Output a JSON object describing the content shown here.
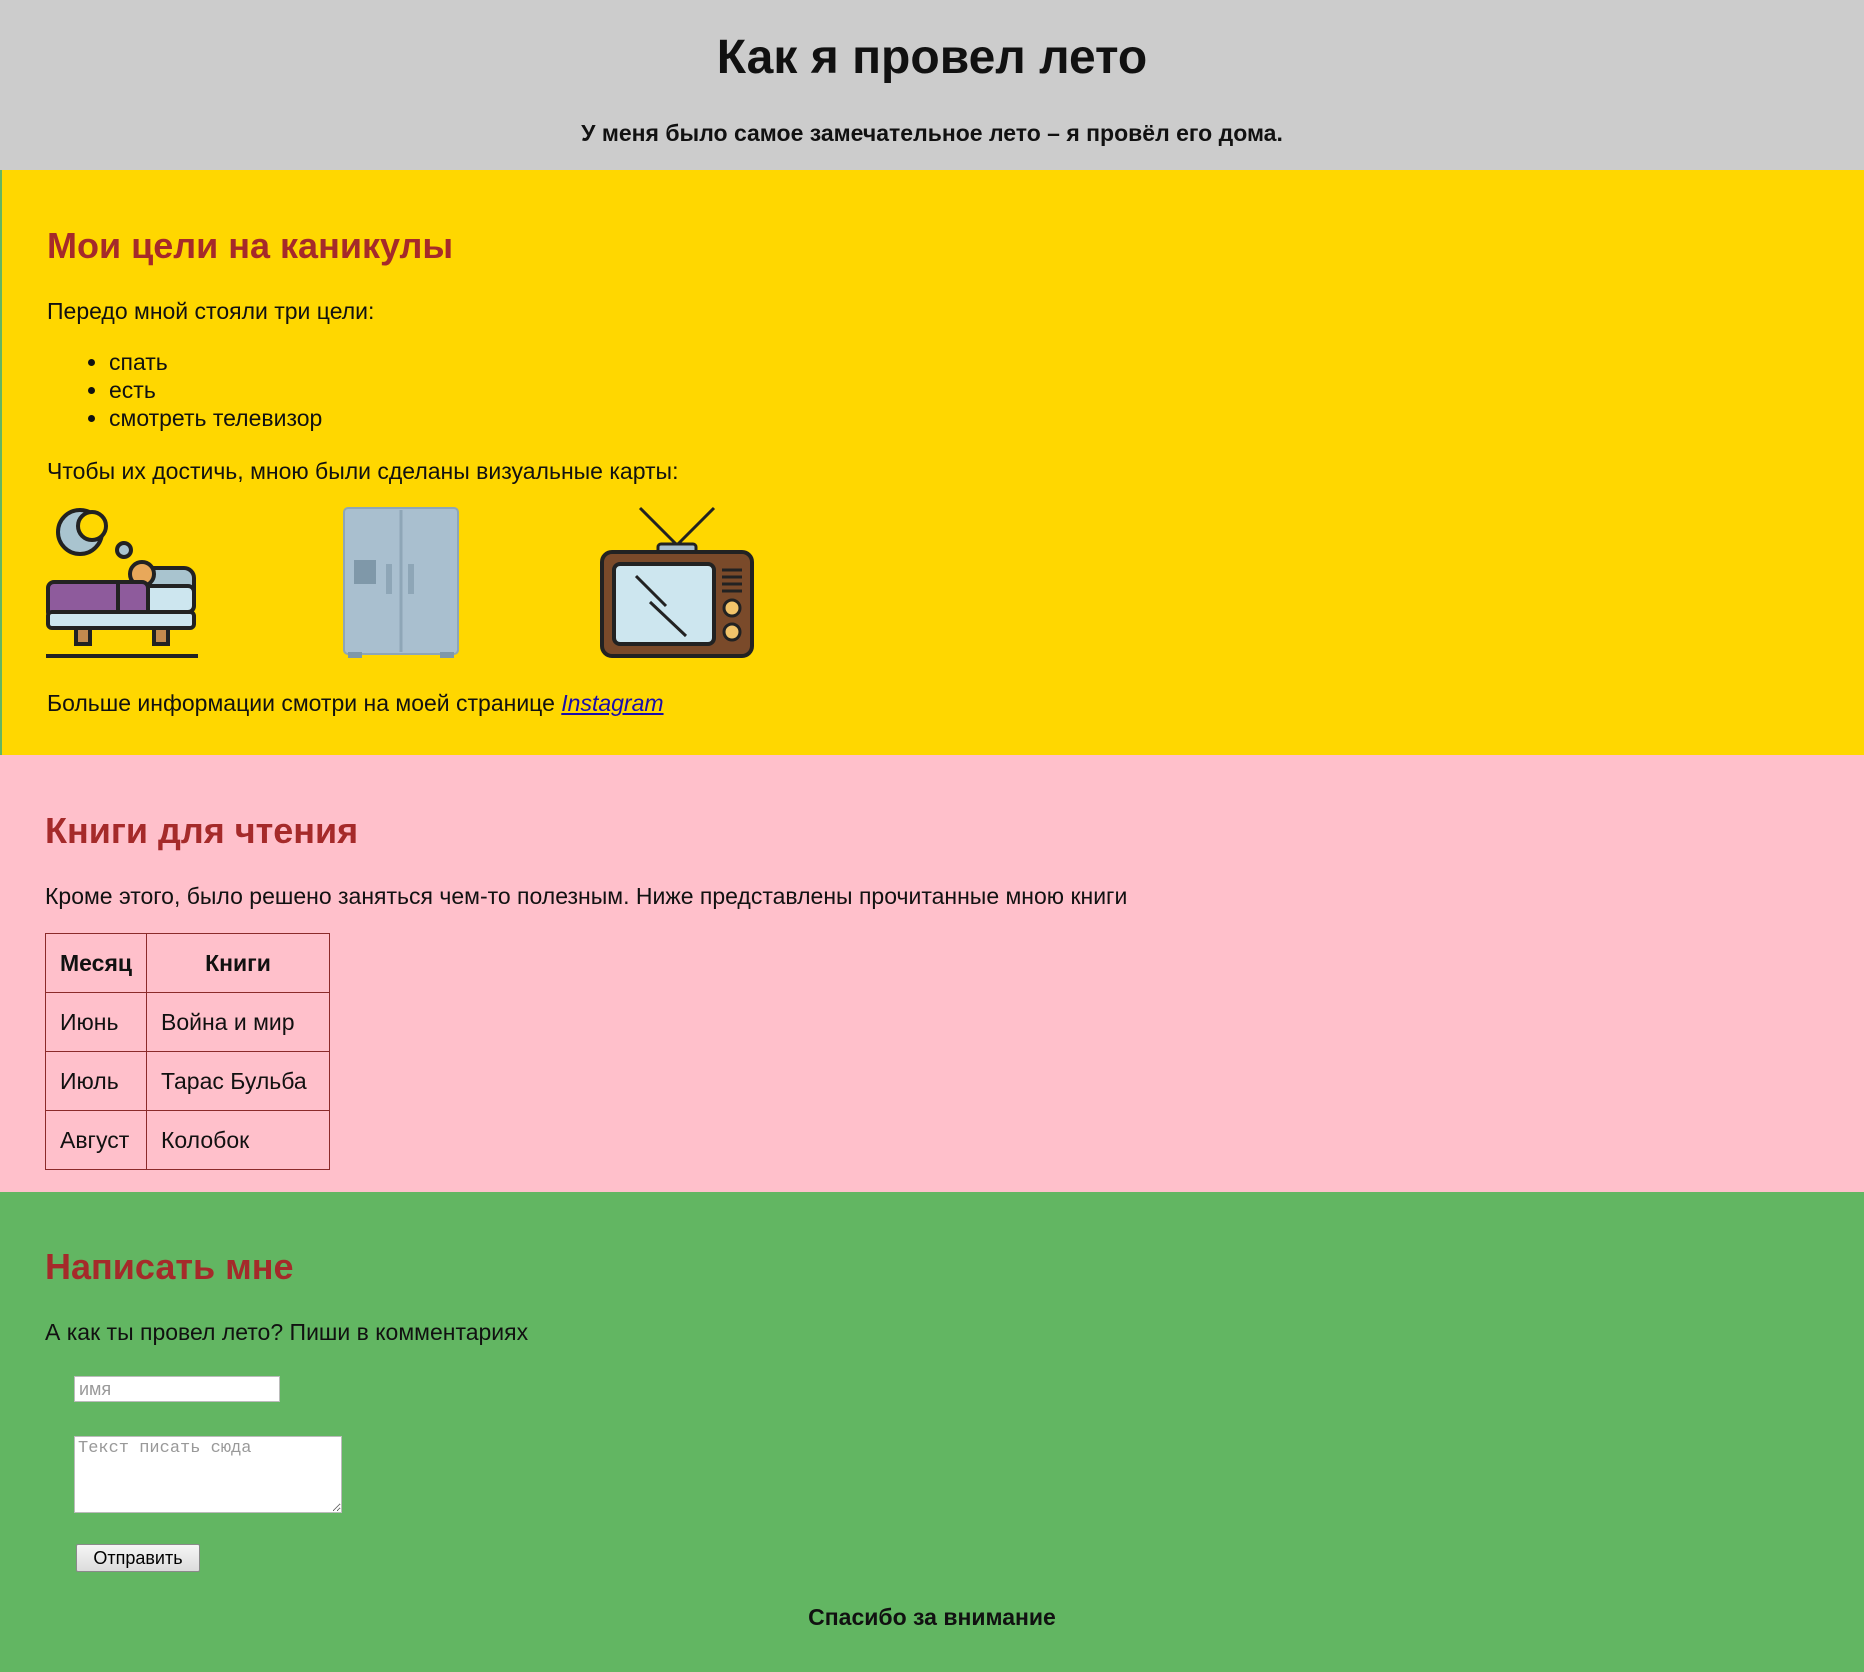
{
  "header": {
    "title": "Как я провел лето",
    "subtitle": "У меня было самое замечательное лето – я провёл его дома."
  },
  "goals_section": {
    "heading": "Мои цели на каникулы",
    "intro": "Передо мной стояли три цели:",
    "items": [
      "спать",
      "есть",
      "смотреть телевизор"
    ],
    "visual_text": "Чтобы их достичь, мною были сделаны визуальные карты:",
    "images": [
      "sleeping-bed-icon",
      "refrigerator-icon",
      "tv-icon"
    ],
    "more_info": "Больше информации смотри на моей странице ",
    "link_label": "Instagram"
  },
  "books_section": {
    "heading": "Книги для чтения",
    "intro": "Кроме этого, было решено заняться чем-то полезным. Ниже представлены прочитанные мною книги",
    "columns": [
      "Месяц",
      "Книги"
    ],
    "rows": [
      [
        "Июнь",
        "Война и мир"
      ],
      [
        "Июль",
        "Тарас Бульба"
      ],
      [
        "Август",
        "Колобок"
      ]
    ]
  },
  "contact_section": {
    "heading": "Написать мне",
    "intro": "А как ты провел лето? Пиши в комментариях",
    "name_placeholder": "имя",
    "text_placeholder": "Текст писать сюда",
    "send_label": "Отправить",
    "thanks": "Спасибо за внимание"
  },
  "colors": {
    "header_bg": "#cccccc",
    "goals_bg": "#ffd700",
    "books_bg": "#ffc0cb",
    "contact_bg": "#62b662",
    "heading_color": "#a52a2a"
  }
}
